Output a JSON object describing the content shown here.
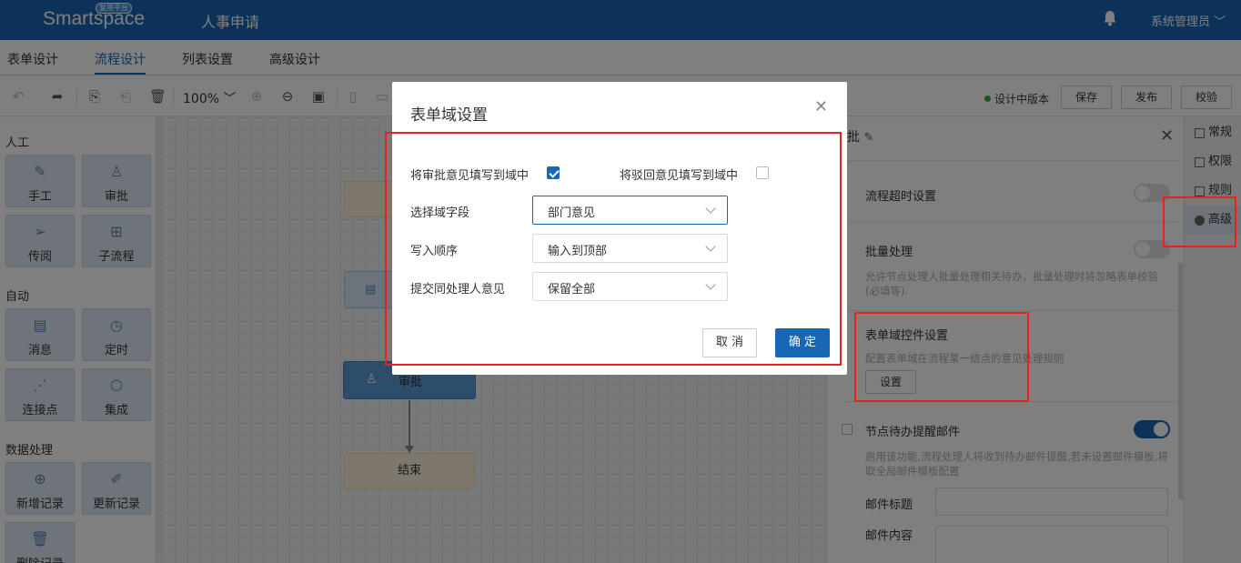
{
  "header": {
    "logo_text": "Smartspace",
    "logo_badge": "复用平台",
    "app_title": "人事申请",
    "user": "系统管理员"
  },
  "tabs": [
    "表单设计",
    "流程设计",
    "列表设置",
    "高级设计"
  ],
  "active_tab": "流程设计",
  "toolbar": {
    "zoom": "100%",
    "version_status": "设计中版本",
    "save_label": "保存",
    "publish_label": "发布",
    "validate_label": "校验"
  },
  "left_panel": {
    "sections": [
      {
        "title": "人工",
        "items": [
          "手工",
          "审批",
          "传阅",
          "子流程"
        ]
      },
      {
        "title": "自动",
        "items": [
          "消息",
          "定时",
          "连接点",
          "集成"
        ]
      },
      {
        "title": "数据处理",
        "items": [
          "新增记录",
          "更新记录",
          "删除记录"
        ]
      }
    ]
  },
  "canvas": {
    "nodes": [
      "审批",
      "结束"
    ]
  },
  "right_panel": {
    "title_partial": "批",
    "timeout_label": "流程超时设置",
    "batch_label": "批量处理",
    "batch_desc": "允许节点处理人批量处理相关待办，批量处理时将忽略表单校验(必填等).",
    "field_ctrl_label": "表单域控件设置",
    "field_ctrl_desc": "配置表单域在流程某一结点的意见处理规则",
    "set_btn": "设置",
    "email_label": "节点待办提醒邮件",
    "email_desc": "启用该功能,流程处理人将收到待办邮件提醒,若未设置邮件模板,将取全局邮件模板配置",
    "mail_subject_label": "邮件标题",
    "mail_content_label": "邮件内容",
    "timeout_on": false,
    "batch_on": false,
    "email_on": true
  },
  "side_tabs": [
    "常规",
    "权限",
    "规则",
    "高级"
  ],
  "active_side_tab": "高级",
  "modal": {
    "title": "表单域设置",
    "write_approval_label": "将审批意见填写到域中",
    "write_approval_checked": true,
    "write_reject_label": "将驳回意见填写到域中",
    "write_reject_checked": false,
    "field_label": "选择域字段",
    "field_value": "部门意见",
    "order_label": "写入顺序",
    "order_value": "输入到顶部",
    "same_handler_label": "提交同处理人意见",
    "same_handler_value": "保留全部",
    "cancel_label": "取 消",
    "ok_label": "确 定"
  },
  "colors": {
    "brand": "#1767b5",
    "highlight": "#e82020"
  }
}
